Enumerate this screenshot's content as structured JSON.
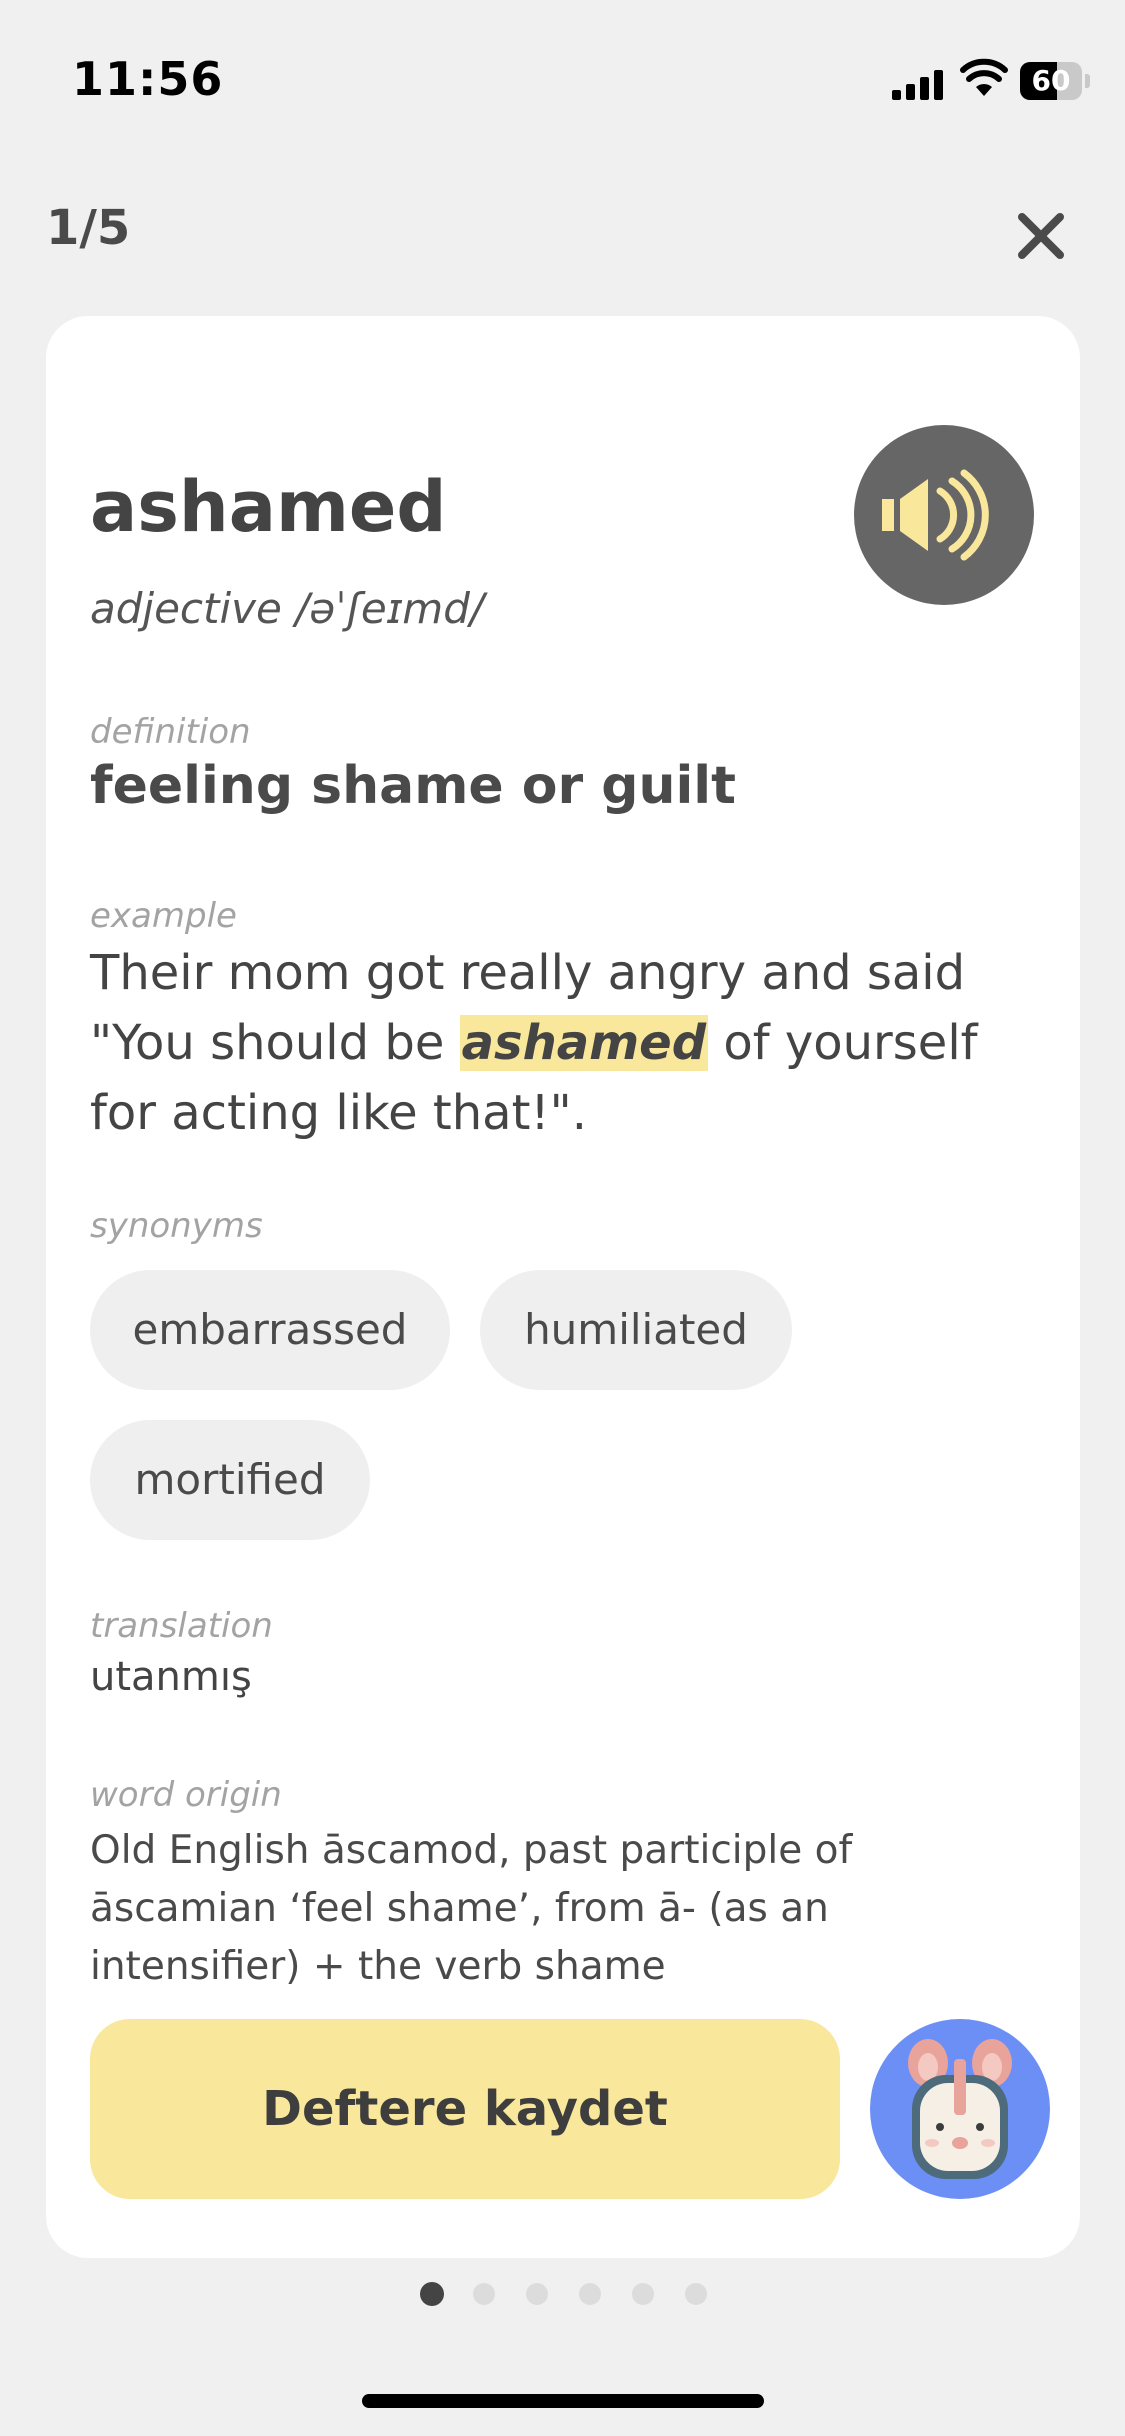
{
  "status_bar": {
    "time": "11:56",
    "battery_percent": "60",
    "battery_level": 0.6
  },
  "header": {
    "progress": "1/5",
    "close_icon": "close-icon"
  },
  "card": {
    "word": "ashamed",
    "part_of_speech": "adjective",
    "pronunciation": "/əˈʃeɪmd/",
    "speaker_icon": "speaker-icon",
    "definition_label": "definition",
    "definition": "feeling shame or guilt",
    "example_label": "example",
    "example": {
      "before": "Their mom got really angry and said \"You should be ",
      "highlight": "ashamed",
      "after": " of yourself for acting like that!\"."
    },
    "synonyms_label": "synonyms",
    "synonyms": [
      "embarrassed",
      "humiliated",
      "mortified"
    ],
    "translation_label": "translation",
    "translation": "utanmış",
    "origin_label": "word origin",
    "origin": "Old English āscamod, past participle of āscamian ‘feel shame’, from ā- (as an intensifier) + the verb shame",
    "save_button": "Deftere kaydet",
    "mascot_icon": "bunny-mascot-icon"
  },
  "pagination": {
    "total": 6,
    "active_index": 0
  },
  "colors": {
    "background": "#f0f0f0",
    "card": "#ffffff",
    "accent_yellow": "#f9e79b",
    "speaker_bg": "#666666",
    "mascot_bg": "#6b8ff5"
  }
}
